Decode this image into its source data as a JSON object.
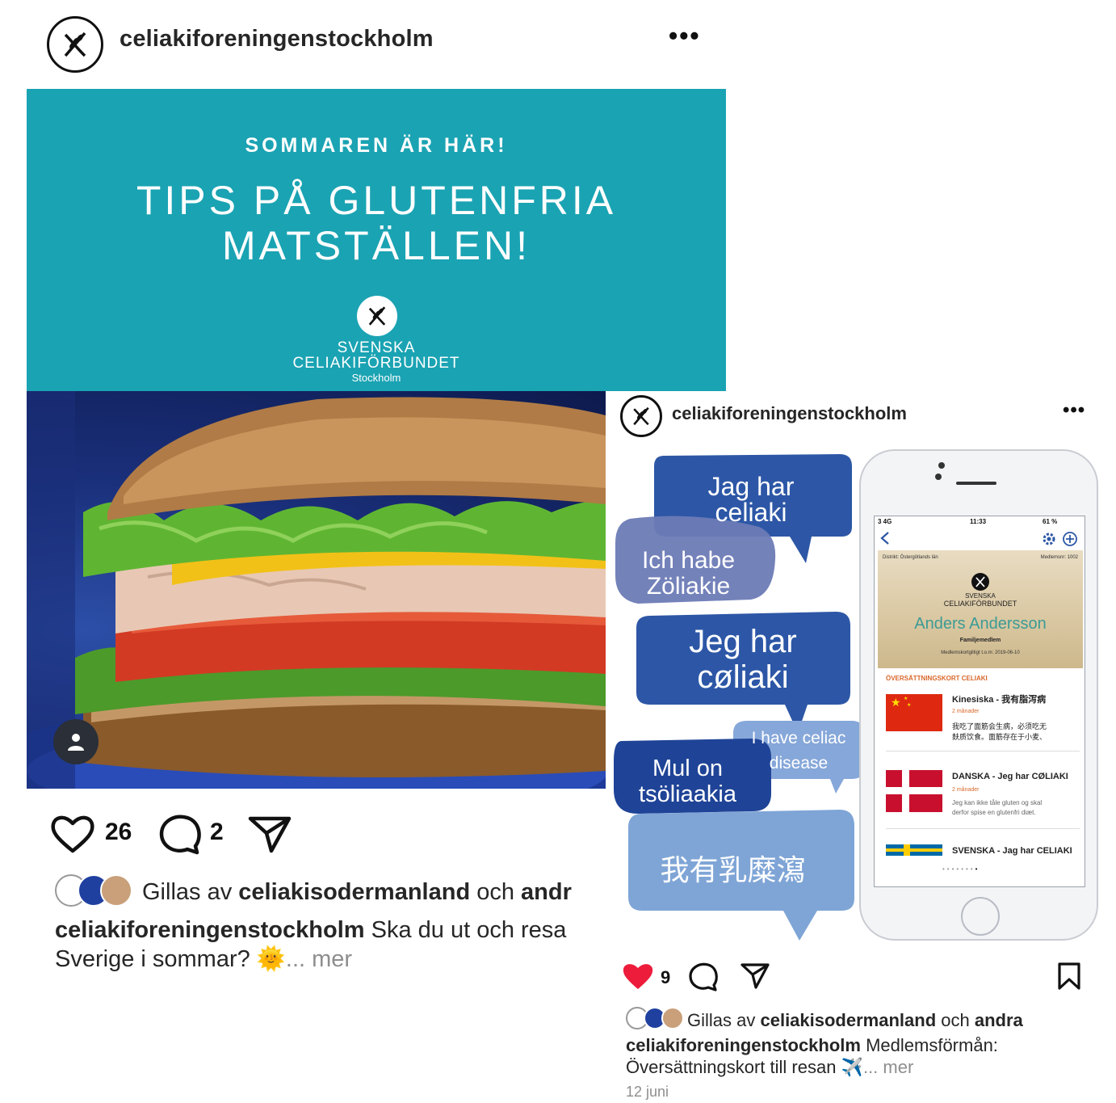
{
  "post1": {
    "username": "celiakiforeningenstockholm",
    "more_label": "•••",
    "banner": {
      "subtitle": "SOMMAREN ÄR HÄR!",
      "title_line1": "TIPS PÅ GLUTENFRIA",
      "title_line2": "MATSTÄLLEN!",
      "org_line1": "SVENSKA",
      "org_line2": "CELIAKIFÖRBUNDET",
      "org_line3": "Stockholm",
      "color": "#1aa3b3"
    },
    "likes": "26",
    "comments": "2",
    "liked_by_prefix": "Gillas av ",
    "liked_by_user": "celiakisodermanland",
    "liked_by_mid": " och ",
    "liked_by_rest": "andr",
    "caption_user": "celiakiforeningenstockholm",
    "caption_text": " Ska du ut och resa",
    "caption_line2": "Sverige i sommar? ",
    "caption_emoji": "🌞",
    "caption_more": "... mer"
  },
  "post2": {
    "username": "celiakiforeningenstockholm",
    "more_label": "•••",
    "bubbles": {
      "sv": [
        "Jag har",
        "celiaki"
      ],
      "de": [
        "Ich habe",
        "Zöliakie"
      ],
      "da": [
        "Jeg har",
        "cøliaki"
      ],
      "en": [
        "I have celiac",
        "disease"
      ],
      "et": [
        "Mul on",
        "tsöliaakia"
      ],
      "zh": "我有乳糜瀉"
    },
    "phone": {
      "carrier": "3  4G",
      "time": "11:33",
      "battery": "61 %",
      "district": "Distrikt: Östergötlands län",
      "member_no": "Medlemsnr: 1002",
      "org_line1": "SVENSKA",
      "org_line2": "CELIAKIFÖRBUNDET",
      "member_name": "Anders Andersson",
      "member_type": "Familjemedlem",
      "valid_until": "Medlemskortgiltigt t.o.m: 2019-06-10",
      "section_title": "ÖVERSÄTTNINGSKORT CELIAKI",
      "cards": [
        {
          "label": "Kinesiska - 我有脂泻病",
          "meta": "2 månader",
          "text1": "我吃了面筋会生病，必须吃无",
          "text2": "麸质饮食。面筋存在于小麦、"
        },
        {
          "label": "DANSKA - Jeg har CØLIAKI",
          "meta": "2 månader",
          "text1": "Jeg kan ikke tåle gluten og skal",
          "text2": "derfor spise en glutenfri diæt."
        },
        {
          "label": "SVENSKA - Jag har CELIAKI",
          "meta": "",
          "text1": "",
          "text2": ""
        }
      ],
      "accent": "#3c9b95"
    },
    "likes": "9",
    "liked_by_prefix": "Gillas av ",
    "liked_by_user": "celiakisodermanland",
    "liked_by_mid": " och ",
    "liked_by_rest": "andra",
    "caption_user": "celiakiforeningenstockholm",
    "caption_text": " Medlemsförmån:",
    "caption_line2": "Översättningskort till resan ",
    "caption_emoji": "✈️",
    "caption_more": "... mer",
    "date": "12 juni",
    "like_color": "#ed1c3b"
  }
}
